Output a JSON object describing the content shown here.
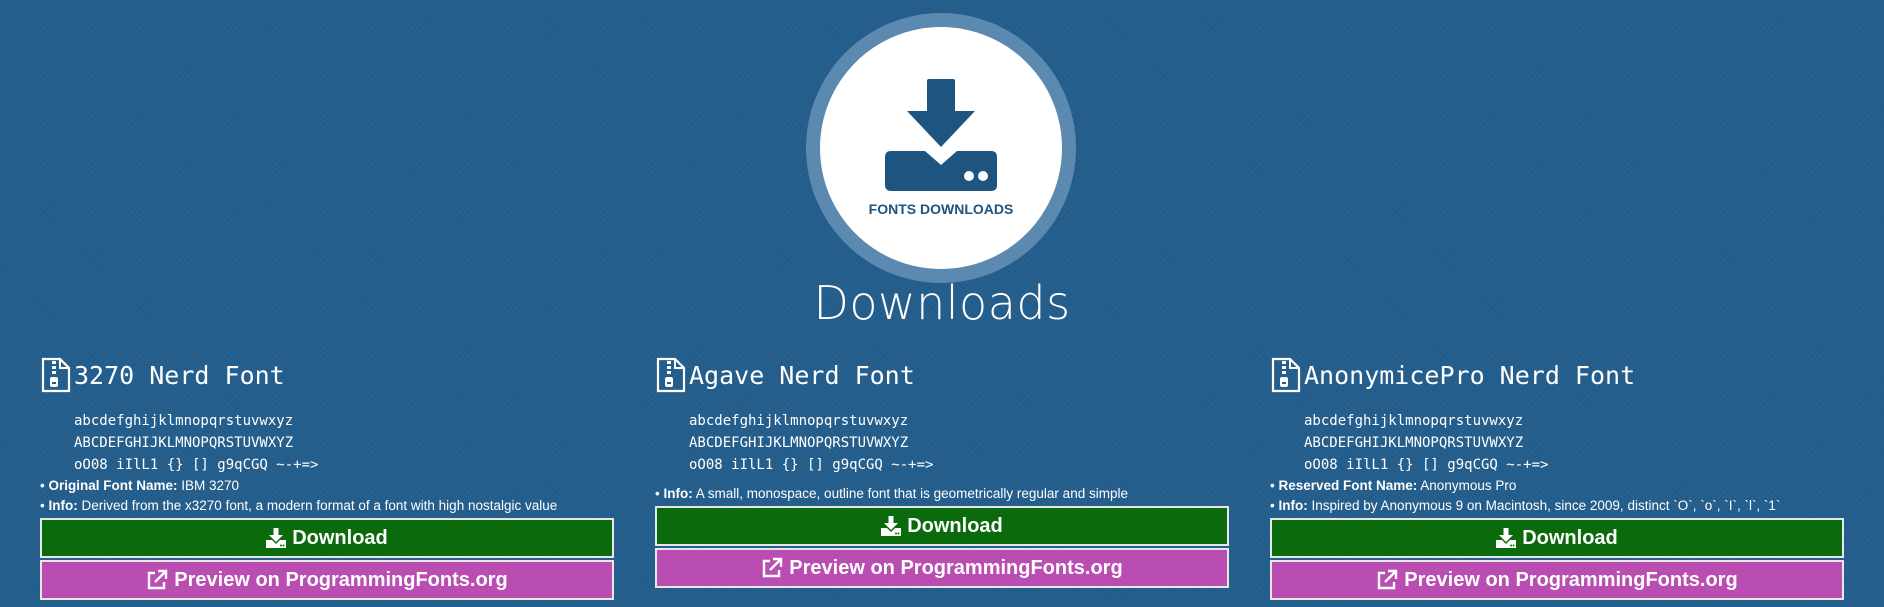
{
  "hero": {
    "label": "FONTS DOWNLOADS",
    "icon": "download-tray-icon",
    "icon_color": "#1d5480"
  },
  "page": {
    "title": "Downloads"
  },
  "colors": {
    "background": "#245e8c",
    "download_button": "#0b6a0b",
    "preview_button": "#ba4db2"
  },
  "fonts": [
    {
      "name": "3270 Nerd Font",
      "sample": [
        "abcdefghijklmnopqrstuvwxyz",
        "ABCDEFGHIJKLMNOPQRSTUVWXYZ",
        "oO08 iIlL1 {} [] g9qCGQ ~-+=>"
      ],
      "info": [
        {
          "label": "Original Font Name:",
          "value": "IBM 3270"
        },
        {
          "label": "Info:",
          "value": "Derived from the x3270 font, a modern format of a font with high nostalgic value"
        }
      ],
      "download_label": "Download",
      "preview_label": "Preview on ProgrammingFonts.org"
    },
    {
      "name": "Agave Nerd Font",
      "sample": [
        "abcdefghijklmnopqrstuvwxyz",
        "ABCDEFGHIJKLMNOPQRSTUVWXYZ",
        "oO08 iIlL1 {} [] g9qCGQ ~-+=>"
      ],
      "info": [
        {
          "label": "Info:",
          "value": "A small, monospace, outline font that is geometrically regular and simple"
        }
      ],
      "download_label": "Download",
      "preview_label": "Preview on ProgrammingFonts.org"
    },
    {
      "name": "AnonymicePro Nerd Font",
      "sample": [
        "abcdefghijklmnopqrstuvwxyz",
        "ABCDEFGHIJKLMNOPQRSTUVWXYZ",
        "oO08 iIlL1 {} [] g9qCGQ ~-+=>"
      ],
      "info": [
        {
          "label": "Reserved Font Name:",
          "value": "Anonymous Pro"
        },
        {
          "label": "Info:",
          "value": "Inspired by Anonymous 9 on Macintosh, since 2009, distinct `O`, `o`, `I`, `l`, `1`"
        }
      ],
      "download_label": "Download",
      "preview_label": "Preview on ProgrammingFonts.org"
    }
  ]
}
